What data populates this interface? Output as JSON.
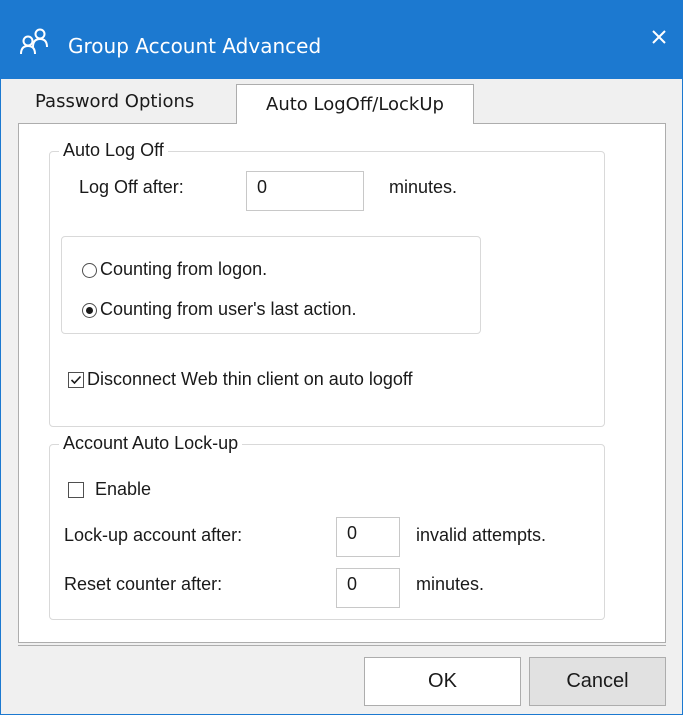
{
  "window": {
    "title": "Group Account Advanced",
    "icon": "group-users-icon",
    "close_glyph": "✕"
  },
  "tabs": [
    {
      "label": "Password Options",
      "active": false
    },
    {
      "label": "Auto LogOff/LockUp",
      "active": true
    }
  ],
  "auto_log_off": {
    "legend": "Auto Log Off",
    "log_off_after_label": "Log Off after:",
    "log_off_after_value": "0",
    "minutes_label": "minutes.",
    "radio_logon_label": "Counting from logon.",
    "radio_last_action_label": "Counting from user's last action.",
    "selected_radio": "last_action",
    "disconnect_label": "Disconnect Web thin client on auto logoff",
    "disconnect_checked": true
  },
  "account_lockup": {
    "legend": "Account Auto Lock-up",
    "enable_label": "Enable",
    "enable_checked": false,
    "lockup_after_label": "Lock-up account after:",
    "lockup_after_value": "0",
    "invalid_attempts_label": "invalid attempts.",
    "reset_counter_label": "Reset counter after:",
    "reset_counter_value": "0",
    "minutes_label": "minutes."
  },
  "buttons": {
    "ok_label": "OK",
    "cancel_label": "Cancel"
  },
  "colors": {
    "titlebar": "#1c79d0",
    "panel": "#ffffff",
    "window_bg": "#f0f0f0"
  }
}
